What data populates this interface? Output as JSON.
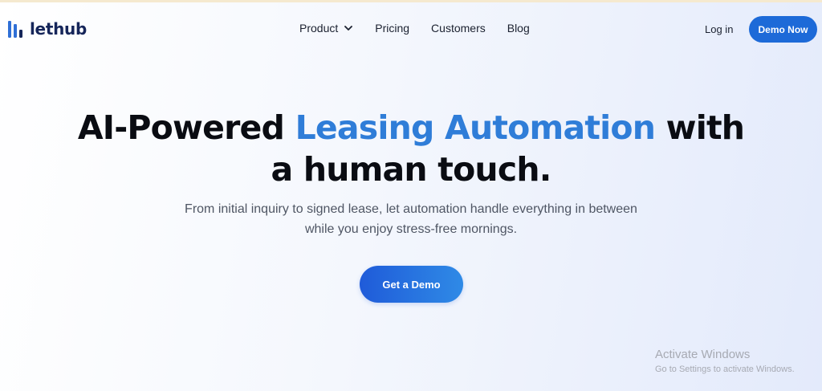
{
  "brand": {
    "name": "lethub",
    "icon": "bars-logo-icon",
    "color": "#16265a",
    "accent": "#2f6fd6"
  },
  "nav": {
    "items": [
      {
        "label": "Product",
        "has_dropdown": true
      },
      {
        "label": "Pricing"
      },
      {
        "label": "Customers"
      },
      {
        "label": "Blog"
      }
    ]
  },
  "header": {
    "login_label": "Log in",
    "demo_label": "Demo Now"
  },
  "hero": {
    "title_part1": "AI-Powered ",
    "title_highlight": "Leasing Automation",
    "title_part2": " with",
    "title_line2": "a human touch.",
    "subtitle_line1": "From initial inquiry to signed lease, let automation handle everything in between",
    "subtitle_line2": "while you enjoy stress-free mornings.",
    "cta_label": "Get a Demo"
  },
  "watermark": {
    "title": "Activate Windows",
    "subtitle": "Go to Settings to activate Windows."
  },
  "colors": {
    "primary_button": "#1d6ad8",
    "highlight_text": "#2f7dd8",
    "heading": "#0a0c12"
  }
}
